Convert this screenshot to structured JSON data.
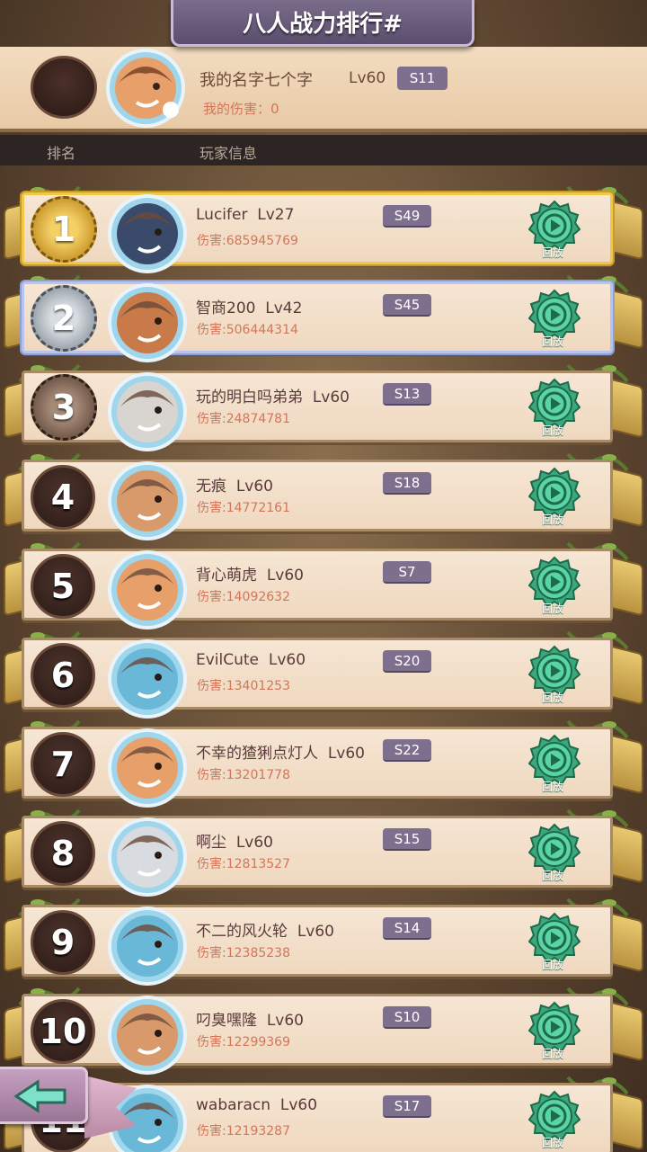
{
  "title": "八人战力排行#",
  "me": {
    "name": "我的名字七个字",
    "level": "Lv60",
    "server": "S11",
    "damage": "我的伤害：0"
  },
  "columns": {
    "rank": "排名",
    "player_info": "玩家信息"
  },
  "replay_label": "回放",
  "rows": [
    {
      "rank": "1",
      "name": "Lucifer",
      "level": "Lv27",
      "server": "S49",
      "damage": "伤害:685945769",
      "avatar_color": "#3a4a6a"
    },
    {
      "rank": "2",
      "name": "智商200",
      "level": "Lv42",
      "server": "S45",
      "damage": "伤害:506444314",
      "avatar_color": "#c87a48"
    },
    {
      "rank": "3",
      "name": "玩的明白吗弟弟",
      "level": "Lv60",
      "server": "S13",
      "damage": "伤害:24874781",
      "avatar_color": "#d8d4d0"
    },
    {
      "rank": "4",
      "name": "无痕",
      "level": "Lv60",
      "server": "S18",
      "damage": "伤害:14772161",
      "avatar_color": "#d89a6a"
    },
    {
      "rank": "5",
      "name": "背心萌虎",
      "level": "Lv60",
      "server": "S7",
      "damage": "伤害:14092632",
      "avatar_color": "#e8a06a"
    },
    {
      "rank": "6",
      "name": "EvilCute",
      "level": "Lv60",
      "server": "S20",
      "damage": "伤害:13401253",
      "avatar_color": "#6ab8d8"
    },
    {
      "rank": "7",
      "name": "不幸的猹猁点灯人",
      "level": "Lv60",
      "server": "S22",
      "damage": "伤害:13201778",
      "avatar_color": "#e8a06a"
    },
    {
      "rank": "8",
      "name": "啊尘",
      "level": "Lv60",
      "server": "S15",
      "damage": "伤害:12813527",
      "avatar_color": "#d8dce0"
    },
    {
      "rank": "9",
      "name": "不二的风火轮",
      "level": "Lv60",
      "server": "S14",
      "damage": "伤害:12385238",
      "avatar_color": "#6ab8d8"
    },
    {
      "rank": "10",
      "name": "叼臭嘿隆",
      "level": "Lv60",
      "server": "S10",
      "damage": "伤害:12299369",
      "avatar_color": "#d89a6a"
    },
    {
      "rank": "11",
      "name": "wabaracn",
      "level": "Lv60",
      "server": "S17",
      "damage": "伤害:12193287",
      "avatar_color": "#6ab8d8"
    }
  ]
}
